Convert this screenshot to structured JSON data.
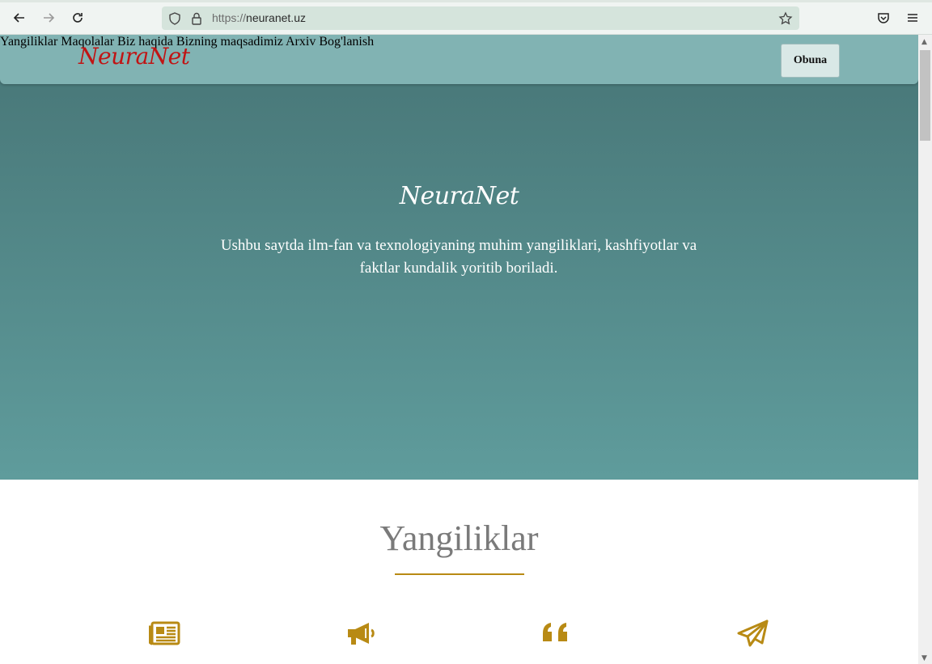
{
  "browser": {
    "url_protocol": "https://",
    "url_host": "neuranet.uz"
  },
  "navbar": {
    "brand": "NeuraNet",
    "menu": [
      {
        "label": "Yangiliklar"
      },
      {
        "label": "Maqolalar"
      },
      {
        "label": "Biz haqida"
      },
      {
        "label": "Bizning maqsadimiz"
      },
      {
        "label": "Arxiv"
      },
      {
        "label": "Bog'lanish"
      }
    ],
    "subscribe_label": "Obuna"
  },
  "hero": {
    "title": "NeuraNet",
    "text": "Ushbu saytda ilm-fan va texnologiyaning muhim yangiliklari, kashfiyotlar va faktlar kundalik yoritib boriladi."
  },
  "section": {
    "title": "Yangiliklar"
  },
  "features": [
    {
      "icon": "newspaper-icon"
    },
    {
      "icon": "megaphone-icon"
    },
    {
      "icon": "quote-icon"
    },
    {
      "icon": "paper-plane-icon"
    }
  ],
  "colors": {
    "accent": "#b88a14",
    "brand": "#c01414",
    "navbar": "#81b3b3",
    "hero_top": "#477576",
    "hero_bottom": "#5f9c9c"
  }
}
